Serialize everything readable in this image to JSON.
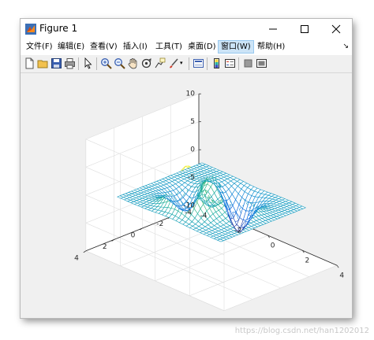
{
  "window": {
    "title": "Figure 1"
  },
  "menu": {
    "items": [
      {
        "label": "文件(F)"
      },
      {
        "label": "编辑(E)"
      },
      {
        "label": "查看(V)"
      },
      {
        "label": "插入(I)"
      },
      {
        "label": "工具(T)"
      },
      {
        "label": "桌面(D)"
      },
      {
        "label": "窗口(W)",
        "active": true
      },
      {
        "label": "帮助(H)"
      }
    ]
  },
  "toolbar": {
    "icons": [
      "new-figure-icon",
      "open-file-icon",
      "save-icon",
      "print-icon",
      "select-arrow-icon",
      "zoom-in-icon",
      "zoom-out-icon",
      "pan-hand-icon",
      "rotate-3d-icon",
      "data-cursor-icon",
      "brush-icon",
      "link-plot-icon",
      "colorbar-icon",
      "legend-icon",
      "hide-plot-tools-icon",
      "show-plot-tools-icon"
    ]
  },
  "colors": {
    "accent": "#cce4f7",
    "axes_bg": "#ffffff",
    "figure_bg": "#f0f0f0"
  },
  "chart_data": {
    "type": "surface",
    "function": "peaks",
    "x_range": [
      -4,
      4
    ],
    "y_range": [
      -4,
      4
    ],
    "z_range": [
      -10,
      10
    ],
    "x_ticks": [
      "-4",
      "-2",
      "0",
      "2",
      "4"
    ],
    "y_ticks": [
      "-4",
      "-2",
      "0",
      "2",
      "4"
    ],
    "z_ticks": [
      "10",
      "5",
      "0",
      "-5",
      "-10"
    ],
    "grid": true,
    "colormap": "parula"
  },
  "watermark": "https://blog.csdn.net/han1202012"
}
